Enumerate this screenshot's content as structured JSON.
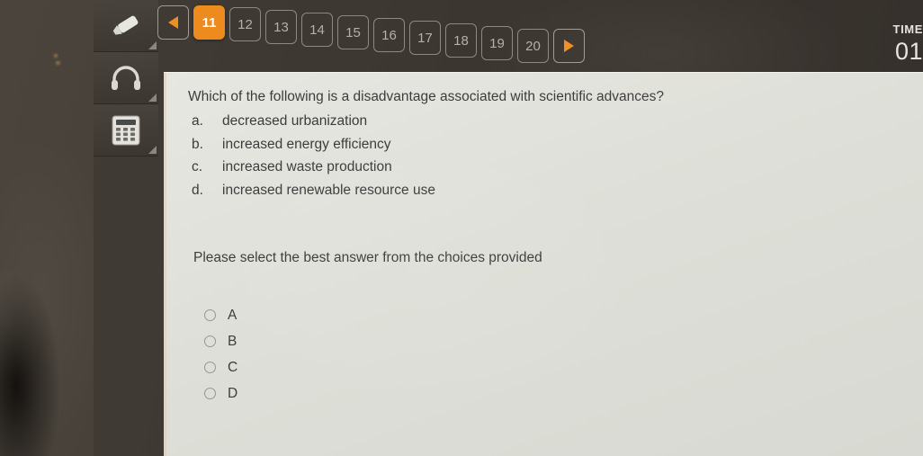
{
  "header": {
    "prev_label": "prev-page",
    "next_label": "next-page",
    "pages": [
      {
        "label": "11",
        "active": true
      },
      {
        "label": "12",
        "active": false
      },
      {
        "label": "13",
        "active": false
      },
      {
        "label": "14",
        "active": false
      },
      {
        "label": "15",
        "active": false
      },
      {
        "label": "16",
        "active": false
      },
      {
        "label": "17",
        "active": false
      },
      {
        "label": "18",
        "active": false
      },
      {
        "label": "19",
        "active": false
      },
      {
        "label": "20",
        "active": false
      }
    ],
    "timer_label": "TIME",
    "timer_value": "01"
  },
  "sidebar": {
    "tools": [
      {
        "icon": "highlighter-icon"
      },
      {
        "icon": "headphones-icon"
      },
      {
        "icon": "calculator-icon"
      }
    ]
  },
  "main": {
    "question": "Which of the following is a disadvantage associated with scientific advances?",
    "choices": [
      {
        "letter": "a.",
        "text": "decreased urbanization"
      },
      {
        "letter": "b.",
        "text": "increased energy efficiency"
      },
      {
        "letter": "c.",
        "text": "increased waste production"
      },
      {
        "letter": "d.",
        "text": "increased renewable resource use"
      }
    ],
    "instruction": "Please select the best answer from the choices provided",
    "radios": [
      {
        "label": "A",
        "selected": false
      },
      {
        "label": "B",
        "selected": false
      },
      {
        "label": "C",
        "selected": false
      },
      {
        "label": "D",
        "selected": false
      }
    ]
  },
  "colors": {
    "accent": "#ed8b1f",
    "chrome": "#3b3630",
    "panel": "#dedfd8",
    "text": "#3c3c3c"
  }
}
